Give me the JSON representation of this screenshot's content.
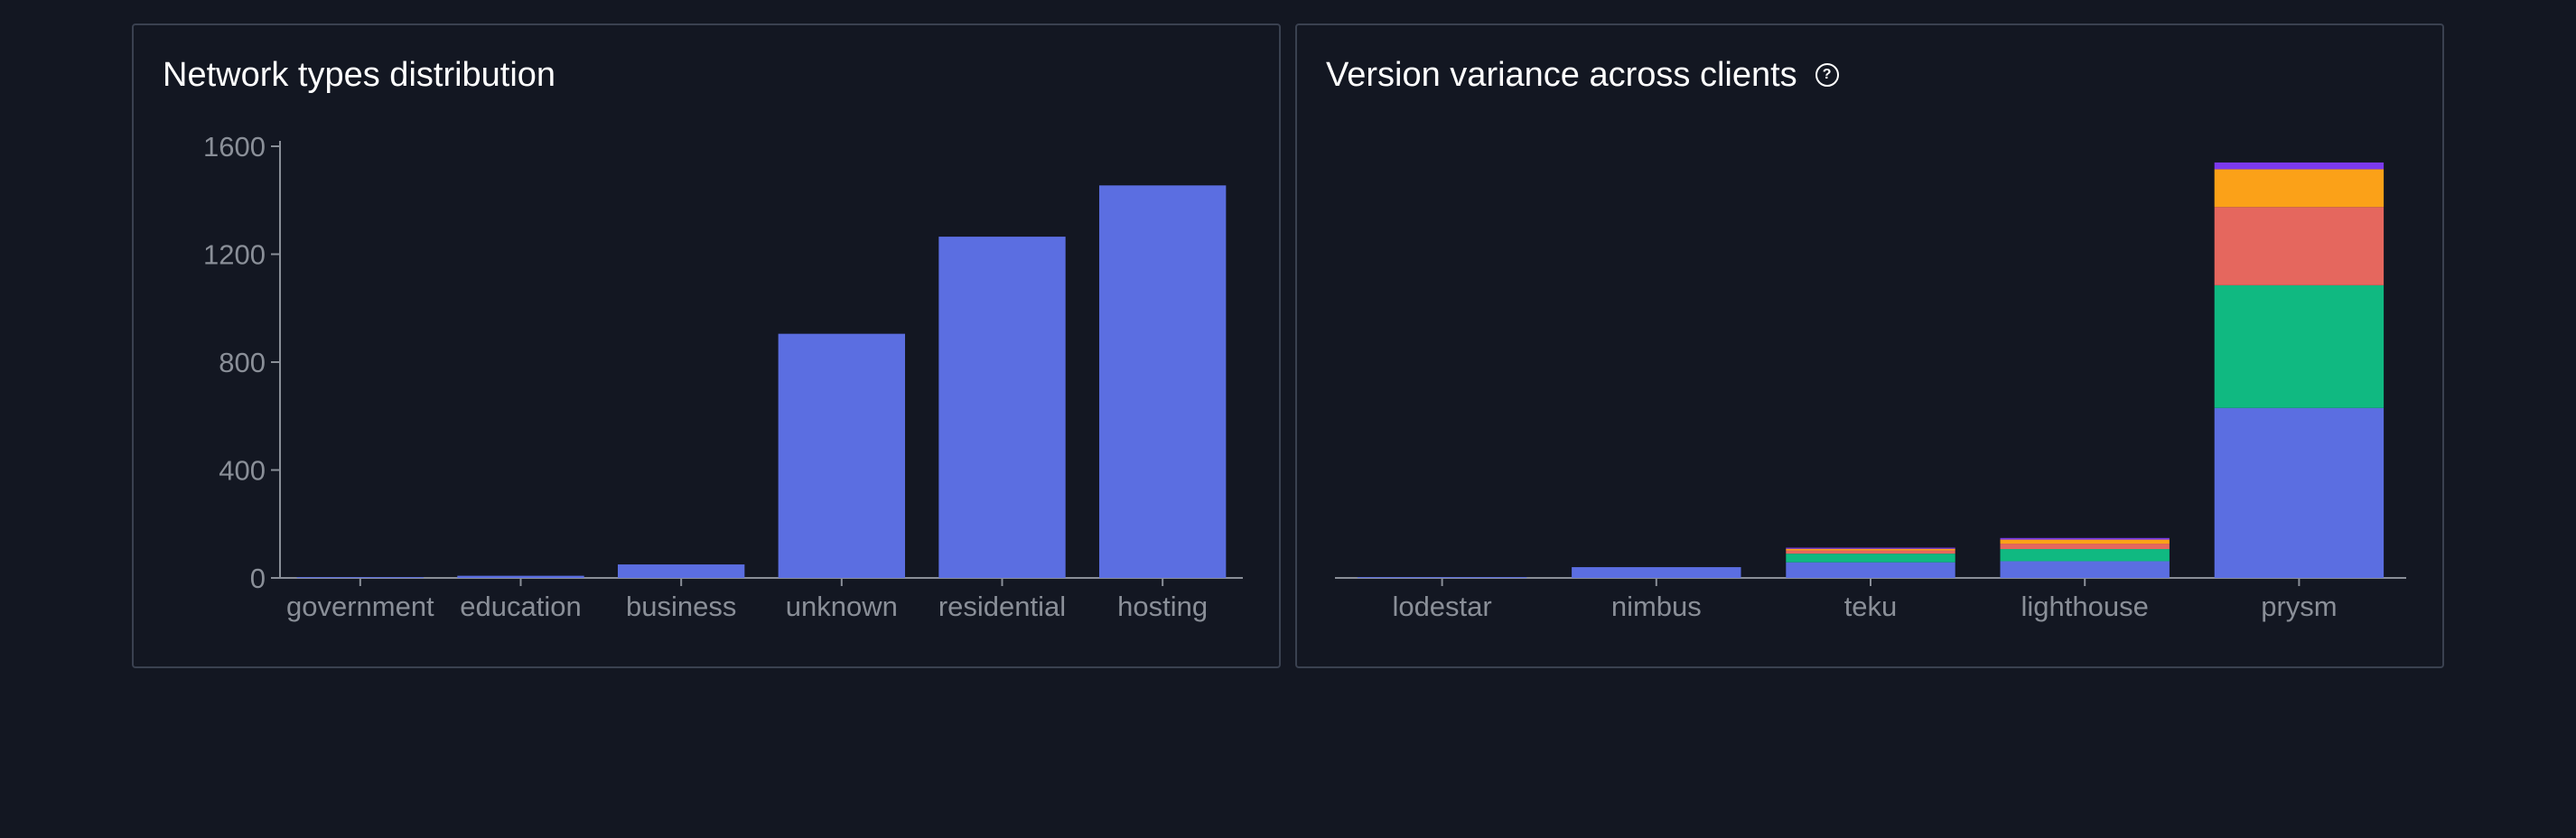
{
  "colors": {
    "background": "#131722",
    "panel_border": "#3a4150",
    "axis": "#8a8f98",
    "bar": "#5b6ee1",
    "segment_2": "#10b981",
    "segment_3": "#e5675e",
    "segment_4": "#fba118",
    "segment_5": "#7c3aed"
  },
  "help_icon": "question-circle-icon",
  "chart_data": [
    {
      "type": "bar",
      "title": "Network types distribution",
      "categories": [
        "government",
        "education",
        "business",
        "unknown",
        "residential",
        "hosting"
      ],
      "values": [
        3,
        8,
        50,
        905,
        1265,
        1455
      ],
      "ylim": [
        0,
        1600
      ],
      "yticks": [
        0,
        400,
        800,
        1200,
        1600
      ],
      "ytick_labels": [
        "0",
        "400",
        "800",
        "1200",
        "1600"
      ],
      "xlabel": "",
      "ylabel": "",
      "grid": false
    },
    {
      "type": "bar",
      "stacked": true,
      "title": "Version variance across clients",
      "categories": [
        "lodestar",
        "nimbus",
        "teku",
        "lighthouse",
        "prysm"
      ],
      "series": [
        {
          "values": [
            3,
            40,
            58,
            62,
            630
          ]
        },
        {
          "values": [
            0,
            0,
            32,
            45,
            455
          ]
        },
        {
          "values": [
            0,
            0,
            12,
            20,
            290
          ]
        },
        {
          "values": [
            0,
            0,
            6,
            15,
            140
          ]
        },
        {
          "values": [
            0,
            0,
            4,
            6,
            25
          ]
        }
      ],
      "ylim": [
        0,
        1600
      ],
      "y_axis_visible": false,
      "xlabel": "",
      "ylabel": "",
      "grid": false
    }
  ]
}
